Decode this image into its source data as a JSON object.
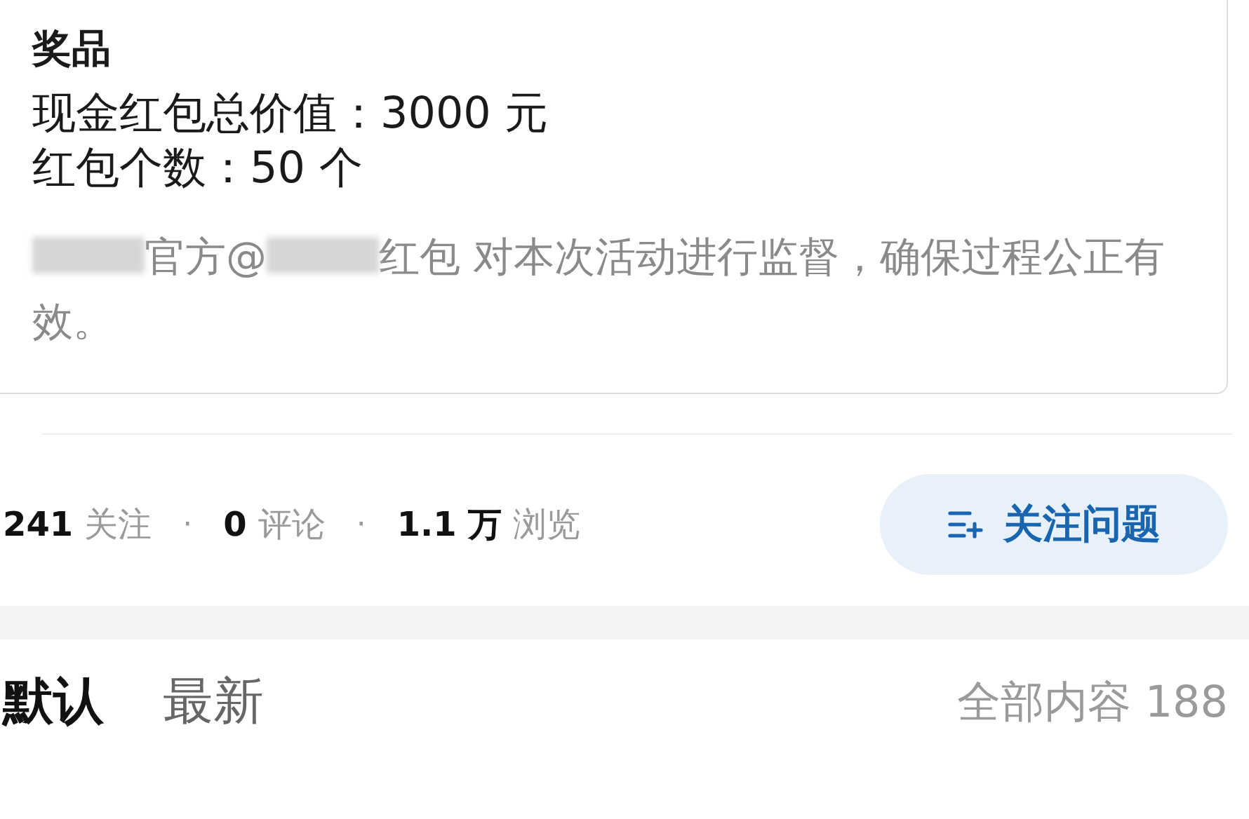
{
  "prize_card": {
    "title": "奖品",
    "lines": [
      "现金红包总价值：3000 元",
      "红包个数：50 个"
    ],
    "note": [
      {
        "kind": "redacted"
      },
      {
        "kind": "text",
        "text": "官方@"
      },
      {
        "kind": "redacted"
      },
      {
        "kind": "text",
        "text": "红包 对本次活动进行监督，确保过程公正有效。"
      }
    ]
  },
  "stats": [
    {
      "number": "241",
      "label": "关注"
    },
    {
      "number": "0",
      "label": "评论"
    },
    {
      "number": "1.1 万",
      "label": "浏览"
    }
  ],
  "stat_separator": "·",
  "follow_button": {
    "label": "关注问题"
  },
  "tabs": [
    {
      "label": "默认",
      "selected": true
    },
    {
      "label": "最新",
      "selected": false
    }
  ],
  "content_count": "全部内容 188"
}
